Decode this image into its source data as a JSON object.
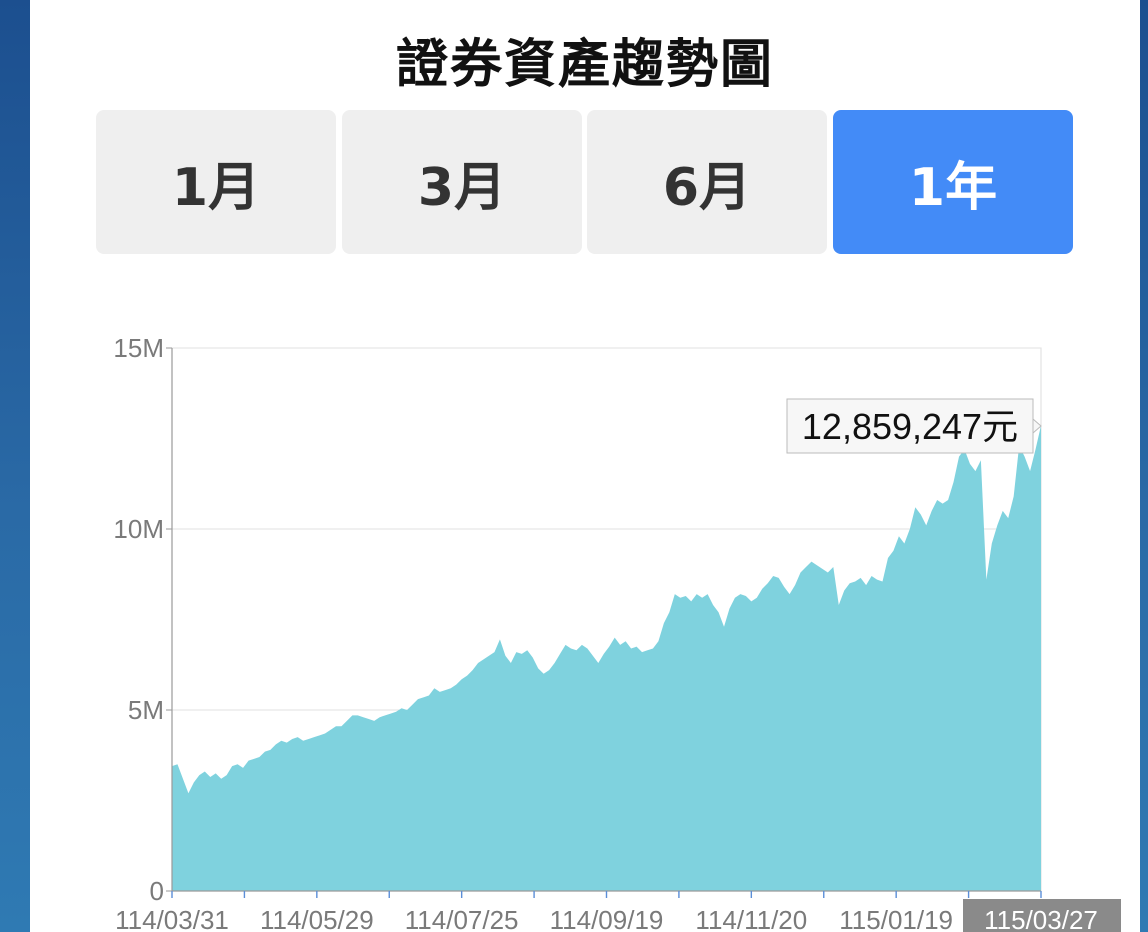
{
  "header": {
    "title": "證券資產趨勢圖"
  },
  "range_tabs": [
    {
      "label": "1月",
      "active": false
    },
    {
      "label": "3月",
      "active": false
    },
    {
      "label": "6月",
      "active": false
    },
    {
      "label": "1年",
      "active": true
    }
  ],
  "colors": {
    "accent": "#438bf7",
    "area_fill": "#7fd2de",
    "tab_bg": "#efefef"
  },
  "chart_data": {
    "type": "area",
    "title": "證券資產趨勢圖",
    "xlabel": "",
    "ylabel": "",
    "ylim": [
      0,
      15000000
    ],
    "y_ticks": [
      "0",
      "5M",
      "10M",
      "15M"
    ],
    "x_ticks": [
      "114/03/31",
      "114/05/29",
      "114/07/25",
      "114/09/19",
      "114/11/20",
      "115/01/19",
      "115/03/27"
    ],
    "highlighted_x_tick": "115/03/27",
    "tooltip": {
      "label": "12,859,247元"
    },
    "grid": true,
    "series": [
      {
        "values": [
          3450000,
          3500000,
          3100000,
          2700000,
          3000000,
          3200000,
          3300000,
          3150000,
          3250000,
          3100000,
          3200000,
          3450000,
          3500000,
          3400000,
          3600000,
          3650000,
          3700000,
          3850000,
          3900000,
          4050000,
          4150000,
          4100000,
          4200000,
          4250000,
          4150000,
          4200000,
          4250000,
          4300000,
          4350000,
          4450000,
          4550000,
          4550000,
          4700000,
          4850000,
          4850000,
          4800000,
          4750000,
          4700000,
          4800000,
          4850000,
          4900000,
          4950000,
          5050000,
          5000000,
          5150000,
          5300000,
          5350000,
          5400000,
          5600000,
          5500000,
          5550000,
          5600000,
          5700000,
          5850000,
          5950000,
          6100000,
          6300000,
          6400000,
          6500000,
          6600000,
          6950000,
          6500000,
          6300000,
          6600000,
          6550000,
          6650000,
          6450000,
          6150000,
          6000000,
          6100000,
          6300000,
          6550000,
          6800000,
          6700000,
          6650000,
          6800000,
          6700000,
          6500000,
          6300000,
          6550000,
          6750000,
          7000000,
          6800000,
          6900000,
          6700000,
          6750000,
          6600000,
          6650000,
          6700000,
          6900000,
          7400000,
          7700000,
          8200000,
          8100000,
          8150000,
          8000000,
          8200000,
          8100000,
          8200000,
          7900000,
          7700000,
          7300000,
          7800000,
          8100000,
          8200000,
          8150000,
          8000000,
          8100000,
          8350000,
          8500000,
          8700000,
          8650000,
          8400000,
          8200000,
          8450000,
          8800000,
          8950000,
          9100000,
          9000000,
          8900000,
          8800000,
          8950000,
          7900000,
          8300000,
          8500000,
          8550000,
          8650000,
          8450000,
          8700000,
          8600000,
          8550000,
          9200000,
          9400000,
          9800000,
          9600000,
          10000000,
          10600000,
          10400000,
          10100000,
          10500000,
          10800000,
          10700000,
          10800000,
          11300000,
          12000000,
          12200000,
          11800000,
          11600000,
          11900000,
          8600000,
          9600000,
          10100000,
          10500000,
          10300000,
          10900000,
          12300000,
          12000000,
          11600000,
          12200000,
          12859247
        ]
      }
    ]
  }
}
